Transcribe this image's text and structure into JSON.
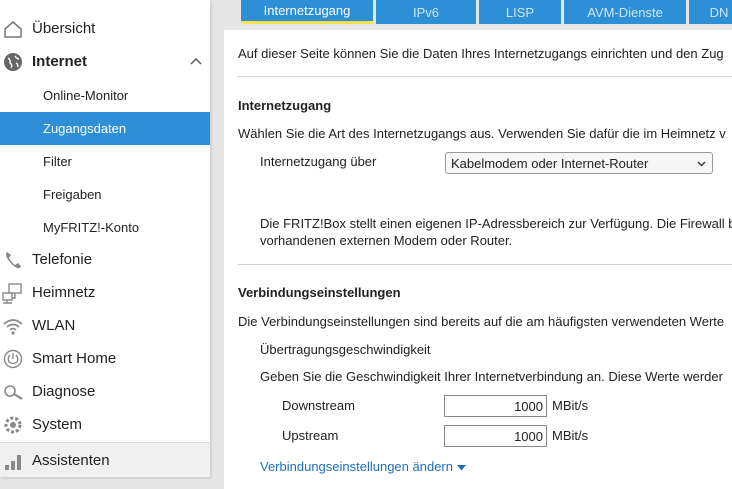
{
  "sidebar": {
    "items": [
      {
        "label": "Übersicht",
        "icon": "home-icon"
      },
      {
        "label": "Internet",
        "icon": "globe-icon",
        "expanded": true
      },
      {
        "label": "Telefonie",
        "icon": "phone-icon"
      },
      {
        "label": "Heimnetz",
        "icon": "network-icon"
      },
      {
        "label": "WLAN",
        "icon": "wifi-icon"
      },
      {
        "label": "Smart Home",
        "icon": "power-icon"
      },
      {
        "label": "Diagnose",
        "icon": "diagnosis-icon"
      },
      {
        "label": "System",
        "icon": "gear-icon"
      },
      {
        "label": "Assistenten",
        "icon": "assistant-icon"
      }
    ],
    "subitems": [
      {
        "label": "Online-Monitor"
      },
      {
        "label": "Zugangsdaten",
        "active": true
      },
      {
        "label": "Filter"
      },
      {
        "label": "Freigaben"
      },
      {
        "label": "MyFRITZ!-Konto"
      }
    ]
  },
  "tabs": [
    {
      "label": "Internetzugang",
      "active": true
    },
    {
      "label": "IPv6"
    },
    {
      "label": "LISP"
    },
    {
      "label": "AVM-Dienste"
    },
    {
      "label": "DN"
    }
  ],
  "main": {
    "intro": "Auf dieser Seite können Sie die Daten Ihres Internetzugangs einrichten und den Zug",
    "access": {
      "heading": "Internetzugang",
      "description": "Wählen Sie die Art des Internetzugangs aus. Verwenden Sie dafür die im Heimnetz v",
      "field_label": "Internetzugang über",
      "select_value": "Kabelmodem oder Internet-Router",
      "info_line1": "Die FRITZ!Box stellt einen eigenen IP-Adressbereich zur Verfügung. Die Firewall b",
      "info_line2": "vorhandenen externen Modem oder Router."
    },
    "connection": {
      "heading": "Verbindungseinstellungen",
      "description": "Die Verbindungseinstellungen sind bereits auf die am häufigsten verwendeten Werte",
      "speed_heading": "Übertragungsgeschwindigkeit",
      "speed_description": "Geben Sie die Geschwindigkeit Ihrer Internetverbindung an. Diese Werte werder",
      "downstream_label": "Downstream",
      "downstream_value": "1000",
      "upstream_label": "Upstream",
      "upstream_value": "1000",
      "unit": "MBit/s",
      "change_link": "Verbindungseinstellungen ändern"
    }
  },
  "colors": {
    "accent": "#2d8fd5",
    "tab_active_underline": "#ffe04a",
    "link": "#1f6fb8"
  }
}
